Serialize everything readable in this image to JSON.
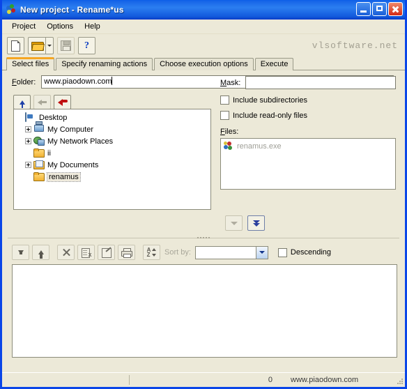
{
  "window": {
    "title_app": "New project",
    "title_sep": " - ",
    "title_prog": "Rename*us",
    "icon": "renamus-app-icon",
    "minimize": "Minimize",
    "maximize": "Maximize",
    "close": "Close"
  },
  "menu": {
    "items": [
      {
        "label": "Project"
      },
      {
        "label": "Options"
      },
      {
        "label": "Help"
      }
    ]
  },
  "toolbar": {
    "new_label": "New project",
    "open_label": "Open project",
    "open_dropdown_label": "Recent projects",
    "save_label": "Save project",
    "help_label": "Help",
    "brand": "vlsoftware.net"
  },
  "tabs": [
    {
      "label": "Select files",
      "active": true
    },
    {
      "label": "Specify renaming actions",
      "active": false
    },
    {
      "label": "Choose execution options",
      "active": false
    },
    {
      "label": "Execute",
      "active": false
    }
  ],
  "select_files": {
    "folder_label_pre": "F",
    "folder_label_post": "older:",
    "folder_value": "www.piaodown.com",
    "folder_placeholder": "",
    "nav": {
      "up_label": "Up one level",
      "back_label": "Back",
      "undo_label": "Previous folder"
    },
    "tree": [
      {
        "label": "Desktop",
        "icon": "desktop-icon",
        "indent": 0,
        "expander": "none",
        "selected": false
      },
      {
        "label": "My Computer",
        "icon": "computer-icon",
        "indent": 1,
        "expander": "plus",
        "selected": false
      },
      {
        "label": "My Network Places",
        "icon": "network-icon",
        "indent": 1,
        "expander": "plus",
        "selected": false
      },
      {
        "label": "ii",
        "icon": "folder-icon",
        "indent": 1,
        "expander": "none",
        "selected": false
      },
      {
        "label": "My Documents",
        "icon": "documents-icon",
        "indent": 1,
        "expander": "plus",
        "selected": false
      },
      {
        "label": "renamus",
        "icon": "folder-icon",
        "indent": 1,
        "expander": "none",
        "selected": true
      }
    ],
    "mask_label_pre": "M",
    "mask_label_post": "ask:",
    "mask_value": "",
    "include_subdirectories": {
      "label": "Include subdirectories",
      "checked": false
    },
    "include_readonly": {
      "label": "Include read-only files",
      "checked": false
    },
    "files_label_pre": "F",
    "files_label_post": "iles:",
    "files": [
      {
        "name": "renamus.exe",
        "icon": "application-icon"
      }
    ],
    "add_selected_label": "Add selected file",
    "add_all_label": "Add all files"
  },
  "list_toolbar": {
    "move_down_label": "Move down",
    "move_up_label": "Move up",
    "remove_label": "Remove",
    "clear_label": "Clear list",
    "edit_label": "Edit entry",
    "print_label": "Print list",
    "sort_label": "Sort",
    "sort_by_label": "Sort by:",
    "sort_by_value": "",
    "descending": {
      "label": "Descending",
      "checked": false
    }
  },
  "file_list": {
    "items": []
  },
  "statusbar": {
    "left": "",
    "count": "0",
    "site": "www.piaodown.com"
  },
  "colors": {
    "titlebar_blue": "#1866E8",
    "window_border": "#0A46E8",
    "face": "#ECE9D8",
    "tab_active_accent": "#F5A623",
    "disabled_text": "#9E9E96"
  }
}
